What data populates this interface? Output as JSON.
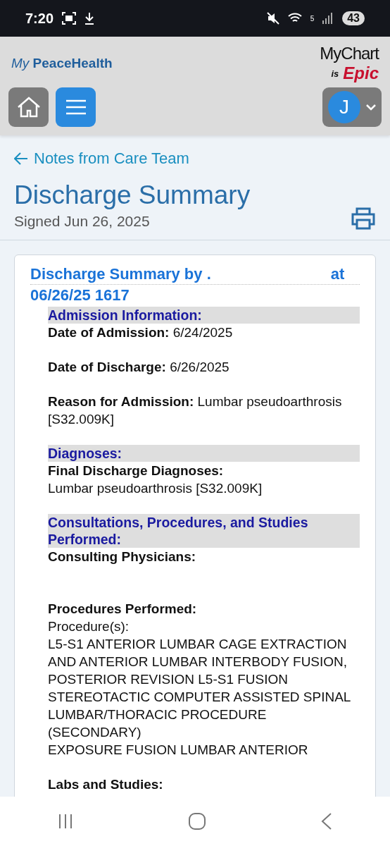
{
  "status_bar": {
    "time": "7:20",
    "wifi_badge": "5",
    "battery": "43"
  },
  "header": {
    "brand_prefix": "My",
    "brand_name": "PeaceHealth",
    "mychart": "MyChart",
    "is": "is",
    "epic": "Epic",
    "avatar_letter": "J"
  },
  "back_link": "Notes from Care Team",
  "page_title": "Discharge Summary",
  "signed": "Signed Jun 26, 2025",
  "note": {
    "title_start": "Discharge Summary by .",
    "title_end": "at",
    "title_time": "06/26/25 1617",
    "sections": [
      {
        "heading": "Admission Information:",
        "items": [
          {
            "kind": "field",
            "label": "Date of Admission:",
            "value": "6/24/2025"
          },
          {
            "kind": "field",
            "label": "Date of Discharge:",
            "value": "6/26/2025"
          },
          {
            "kind": "field",
            "label": "Reason for Admission:",
            "value": "Lumbar pseudoarthrosis [S32.009K]"
          }
        ]
      },
      {
        "heading": "Diagnoses:",
        "items": [
          {
            "kind": "block",
            "label": "Final Discharge Diagnoses:",
            "lines": [
              "Lumbar pseudoarthrosis [S32.009K]"
            ]
          }
        ]
      },
      {
        "heading": "Consultations, Procedures, and Studies Performed:",
        "items": [
          {
            "kind": "redacted",
            "label": "Consulting Physicians:"
          },
          {
            "kind": "block",
            "label": "Procedures Performed:",
            "lines": [
              "Procedure(s):",
              "L5-S1 ANTERIOR LUMBAR CAGE EXTRACTION AND ANTERIOR LUMBAR INTERBODY FUSION, POSTERIOR REVISION L5-S1 FUSION",
              "STEREOTACTIC COMPUTER ASSISTED SPINAL LUMBAR/THORACIC PROCEDURE (SECONDARY)",
              "EXPOSURE FUSION LUMBAR ANTERIOR"
            ]
          },
          {
            "kind": "block",
            "label": "Labs and Studies:"
          }
        ]
      }
    ]
  }
}
